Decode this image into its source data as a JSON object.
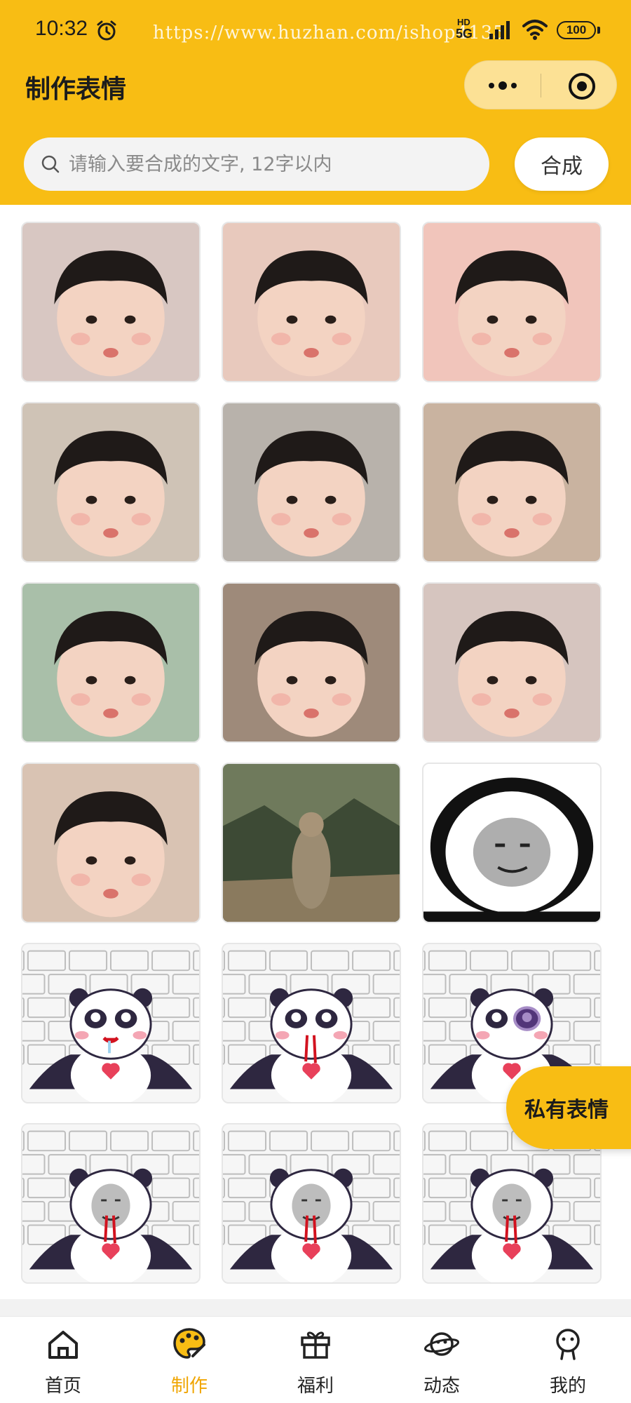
{
  "status_bar": {
    "time": "10:32",
    "watermark": "https://www.huzhan.com/ishop4135",
    "network_badge": "HD",
    "network_type": "5G",
    "battery": "100"
  },
  "header": {
    "title": "制作表情",
    "capsule_more_icon": "more-dots-icon",
    "capsule_close_icon": "target-circle-icon"
  },
  "search": {
    "placeholder": "请输入要合成的文字, 12字以内",
    "value": "",
    "button_label": "合成"
  },
  "stickers": [
    {
      "id": 1,
      "kind": "photo",
      "subject": "toddler-v-sign",
      "bg": "#d8c7c2"
    },
    {
      "id": 2,
      "kind": "photo",
      "subject": "toddler-lying",
      "bg": "#e8c9bd"
    },
    {
      "id": 3,
      "kind": "photo",
      "subject": "toddler-pout-closeup",
      "bg": "#f1c5bb"
    },
    {
      "id": 4,
      "kind": "photo",
      "subject": "toddler-mint-shirt",
      "bg": "#cfc3b6"
    },
    {
      "id": 5,
      "kind": "photo",
      "subject": "toddler-pigtails-surprised",
      "bg": "#b8b2ab"
    },
    {
      "id": 6,
      "kind": "photo",
      "subject": "toddler-red-shirt",
      "bg": "#c9b3a0"
    },
    {
      "id": 7,
      "kind": "photo",
      "subject": "toddler-profile",
      "bg": "#a9bfa9"
    },
    {
      "id": 8,
      "kind": "photo",
      "subject": "toddler-sleepy-red",
      "bg": "#9e8a7a"
    },
    {
      "id": 9,
      "kind": "photo",
      "subject": "toddler-finger-face",
      "bg": "#d6c5bf"
    },
    {
      "id": 10,
      "kind": "photo",
      "subject": "toddler-curly-pout",
      "bg": "#d9c3b3"
    },
    {
      "id": 11,
      "kind": "photo",
      "subject": "marmot-mountain",
      "bg": "#6f7a5c"
    },
    {
      "id": 12,
      "kind": "panda-meme",
      "subject": "panda-angry-face",
      "bg": "#ffffff"
    },
    {
      "id": 13,
      "kind": "panda-cartoon",
      "subject": "panda-drool",
      "bg": "#f4f4f4"
    },
    {
      "id": 14,
      "kind": "panda-cartoon",
      "subject": "panda-nosebleed",
      "bg": "#f4f4f4"
    },
    {
      "id": 15,
      "kind": "panda-cartoon",
      "subject": "panda-black-eye",
      "bg": "#f4f4f4"
    },
    {
      "id": 16,
      "kind": "panda-cartoon",
      "subject": "panda-face-bleed",
      "bg": "#f4f4f4"
    },
    {
      "id": 17,
      "kind": "panda-cartoon",
      "subject": "panda-face-smile",
      "bg": "#f4f4f4"
    },
    {
      "id": 18,
      "kind": "panda-cartoon",
      "subject": "panda-face-smirk",
      "bg": "#f4f4f4"
    }
  ],
  "float_button": {
    "label": "私有表情"
  },
  "tabbar": {
    "items": [
      {
        "label": "首页",
        "icon": "home-icon",
        "active": false
      },
      {
        "label": "制作",
        "icon": "palette-icon",
        "active": true
      },
      {
        "label": "福利",
        "icon": "gift-icon",
        "active": false
      },
      {
        "label": "动态",
        "icon": "planet-icon",
        "active": false
      },
      {
        "label": "我的",
        "icon": "profile-icon",
        "active": false
      }
    ]
  },
  "colors": {
    "brand": "#f8bd14",
    "active_tab": "#f0a500",
    "text": "#1c1c1c"
  }
}
